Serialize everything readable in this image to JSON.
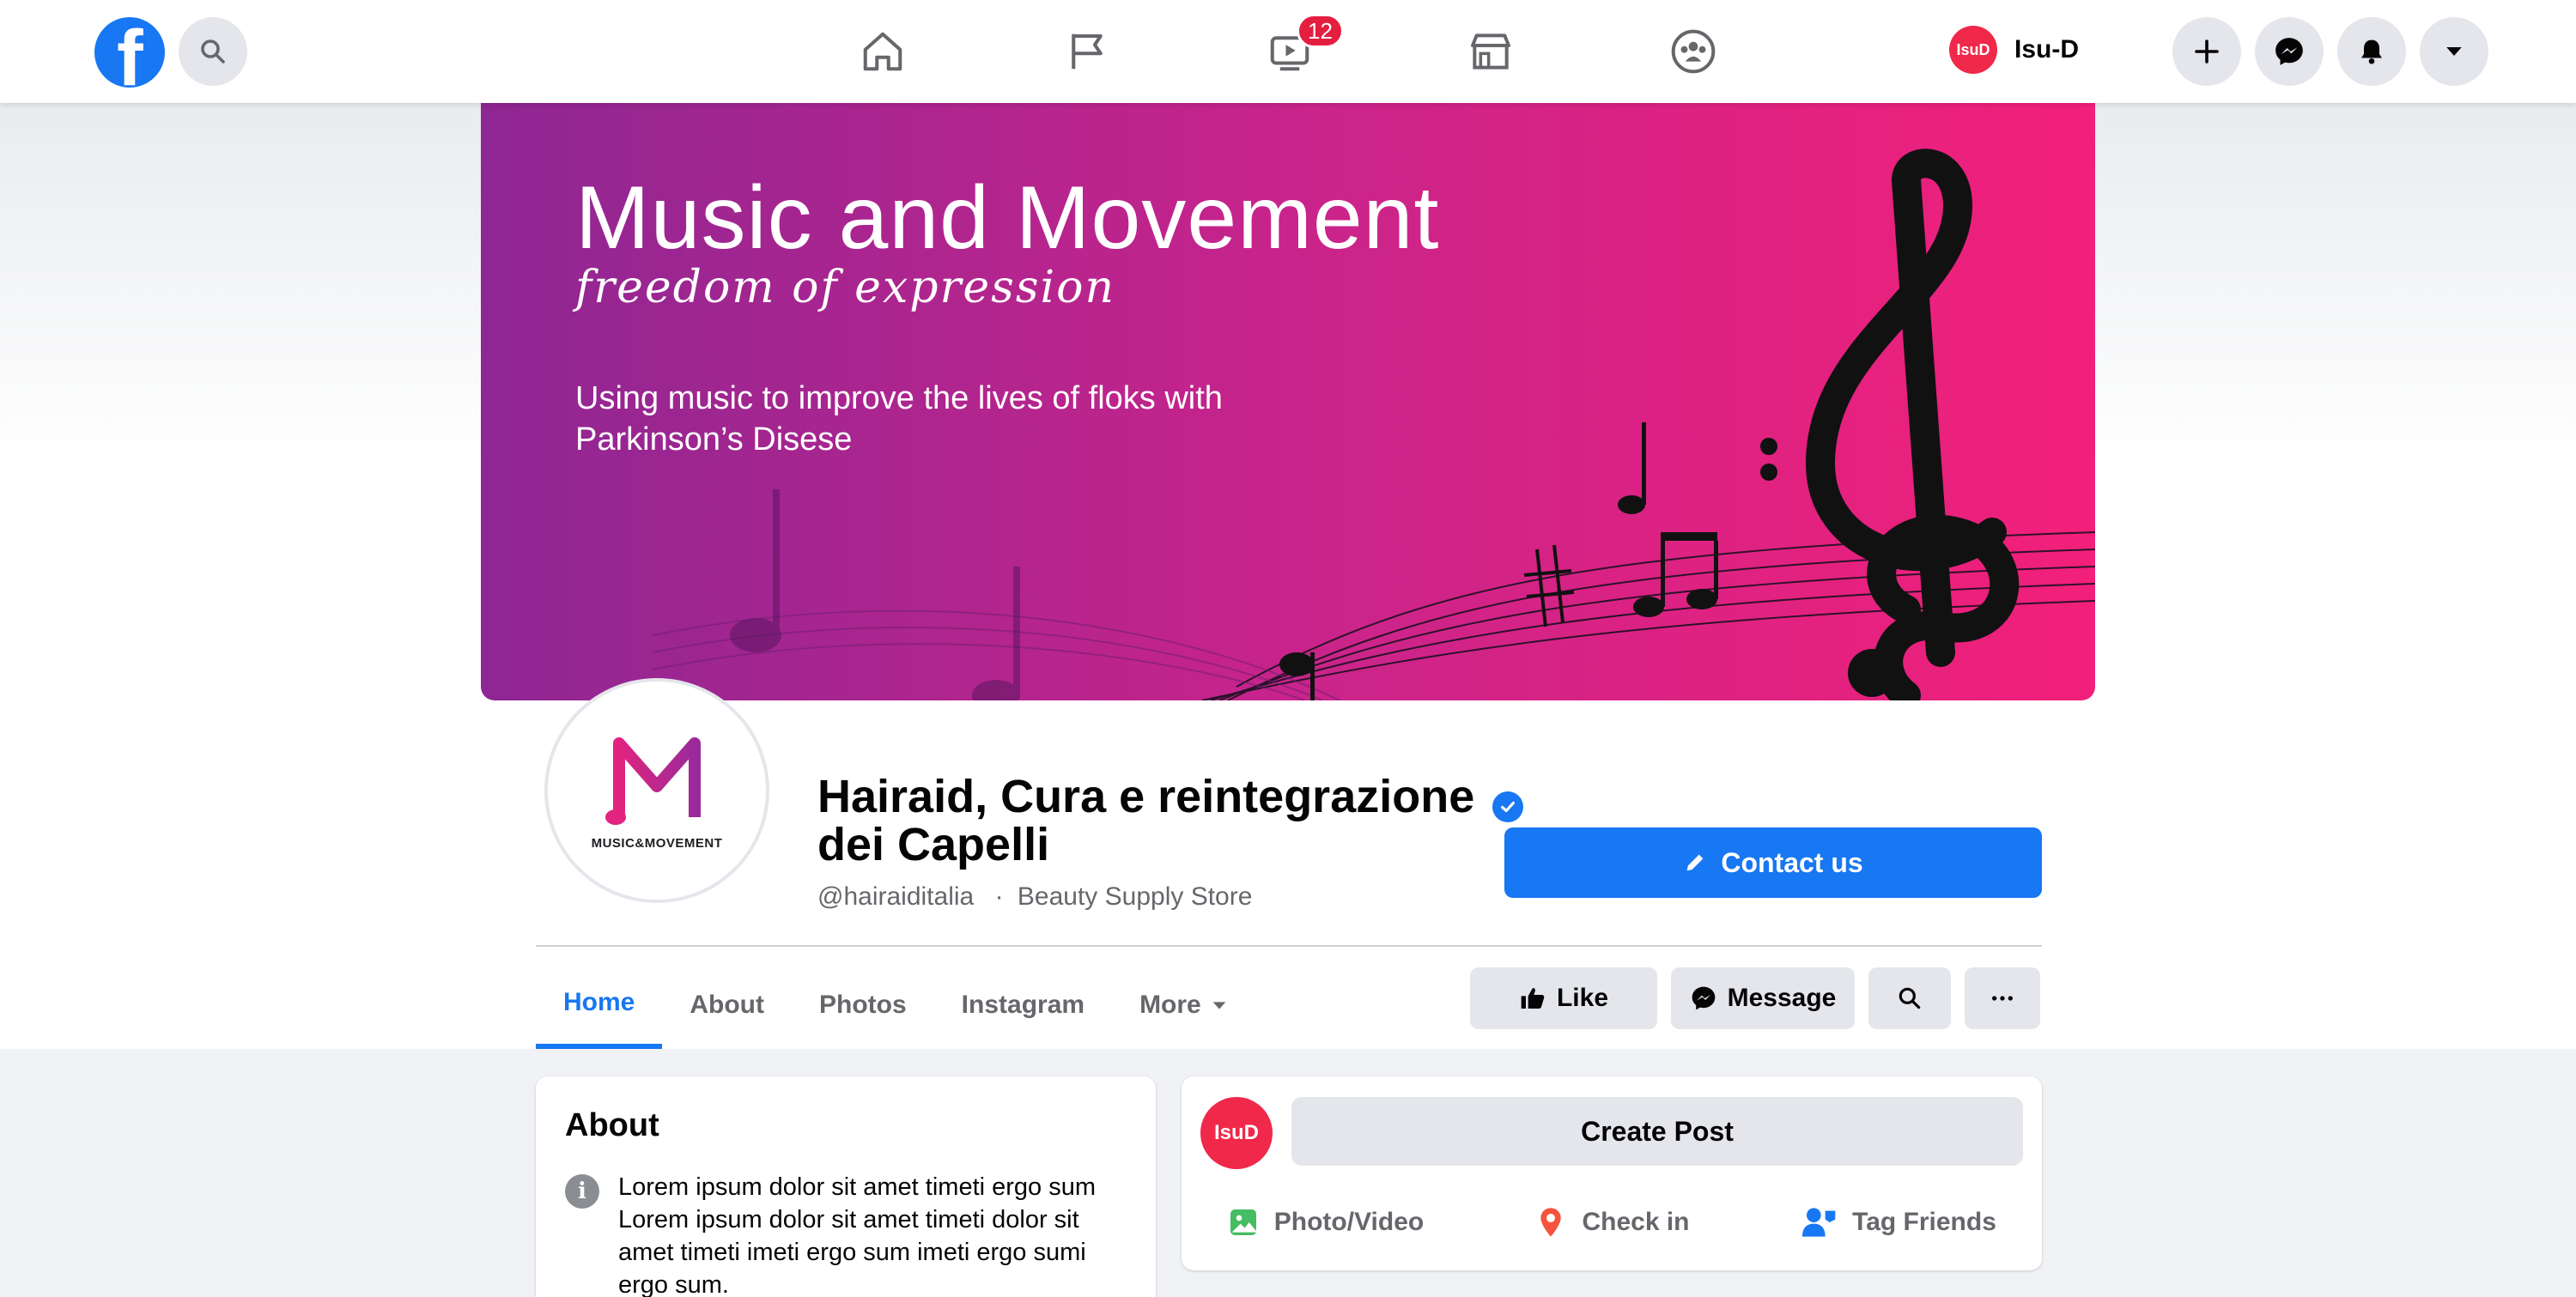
{
  "topbar": {
    "logo_letter": "f",
    "video_badge": "12",
    "user_avatar_text": "IsuD",
    "user_name": "Isu-D"
  },
  "cover": {
    "title": "Music and Movement",
    "subtitle": "freedom of expression",
    "text": "Using music to improve the lives of floks with Parkinson’s Disese"
  },
  "profile": {
    "logo_text": "MUSIC&MOVEMENT",
    "name": "Hairaid, Cura e reintegrazione dei Capelli",
    "handle": "@hairaiditalia",
    "separator": "·",
    "category": "Beauty Supply Store",
    "contact_label": "Contact us"
  },
  "tabs": [
    {
      "label": "Home",
      "active": true
    },
    {
      "label": "About"
    },
    {
      "label": "Photos"
    },
    {
      "label": "Instagram"
    },
    {
      "label": "More"
    }
  ],
  "actions": {
    "like": "Like",
    "message": "Message"
  },
  "about": {
    "title": "About",
    "text": "Lorem ipsum dolor sit amet timeti ergo sum Lorem ipsum dolor sit amet timeti dolor sit amet timeti imeti ergo sum imeti ergo sumi ergo sum."
  },
  "post": {
    "avatar_text": "IsuD",
    "create_label": "Create Post",
    "photo_video": "Photo/Video",
    "check_in": "Check in",
    "tag_friends": "Tag Friends"
  },
  "colors": {
    "accent": "#1877f2",
    "cover_start": "#8e2693",
    "cover_end": "#f2207a",
    "badge": "#e41e3f"
  }
}
